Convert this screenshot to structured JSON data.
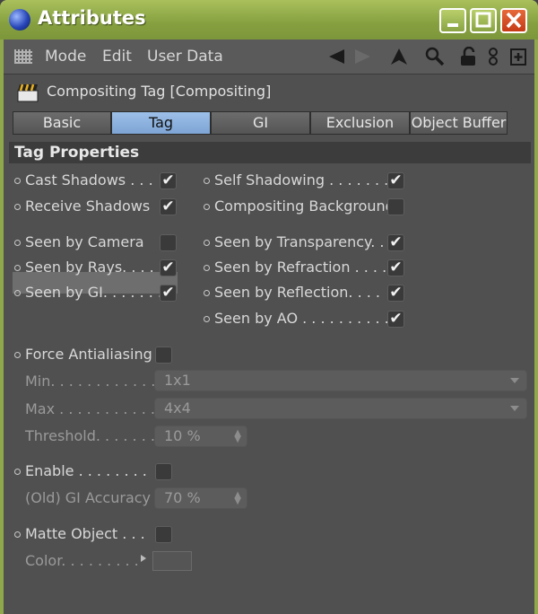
{
  "window": {
    "title": "Attributes"
  },
  "menu": {
    "mode": "Mode",
    "edit": "Edit",
    "user_data": "User Data"
  },
  "object_title": "Compositing Tag [Compositing]",
  "tabs": [
    "Basic",
    "Tag",
    "GI",
    "Exclusion",
    "Object Buffer"
  ],
  "active_tab": "Tag",
  "section_title": "Tag Properties",
  "props": {
    "cast_shadows": "Cast Shadows . . .",
    "receive_shadows": "Receive Shadows",
    "self_shadowing": "Self Shadowing . . . . . . . .",
    "compositing_background": "Compositing Background",
    "seen_by_camera": "Seen by Camera",
    "seen_by_rays": "Seen by Rays. . . .",
    "seen_by_gi": "Seen by GI. . . . . . .",
    "seen_by_transparency": "Seen by Transparency. .",
    "seen_by_refraction": "Seen by Refraction . . . .",
    "seen_by_reflection": "Seen by Reflection. . . .",
    "seen_by_ao": "Seen by AO . . . . . . . . . .",
    "force_antialiasing": "Force Antialiasing",
    "min_label": "Min. . . . . . . . . . . .",
    "min_value": "1x1",
    "max_label": "Max . . . . . . . . . . . .",
    "max_value": "4x4",
    "threshold_label": "Threshold. . . . . . .",
    "threshold_value": "10 %",
    "enable": "Enable . . . . . . . .",
    "gi_accuracy_label": "(Old) GI Accuracy",
    "gi_accuracy_value": "70 %",
    "matte_object": "Matte Object . . .",
    "color_label": "Color. . . . . . . . ."
  },
  "checked": {
    "cast_shadows": true,
    "receive_shadows": true,
    "self_shadowing": true,
    "compositing_background": false,
    "seen_by_camera": false,
    "seen_by_rays": true,
    "seen_by_gi": true,
    "seen_by_transparency": true,
    "seen_by_refraction": true,
    "seen_by_reflection": true,
    "seen_by_ao": true,
    "force_antialiasing": false,
    "enable": false,
    "matte_object": false
  },
  "check_glyph": "✔",
  "colors": {
    "titlebar": "#8fa84c",
    "active_tab": "#8fb4e0",
    "panel": "#505050",
    "close": "#d8502a"
  },
  "icons": [
    "app-sphere-icon",
    "minimize-icon",
    "maximize-icon",
    "close-icon",
    "grip-icon",
    "back-arrow-icon",
    "forward-arrow-icon",
    "up-arrow-icon",
    "search-icon",
    "lock-icon",
    "link-icon",
    "new-panel-icon",
    "clapperboard-icon"
  ]
}
